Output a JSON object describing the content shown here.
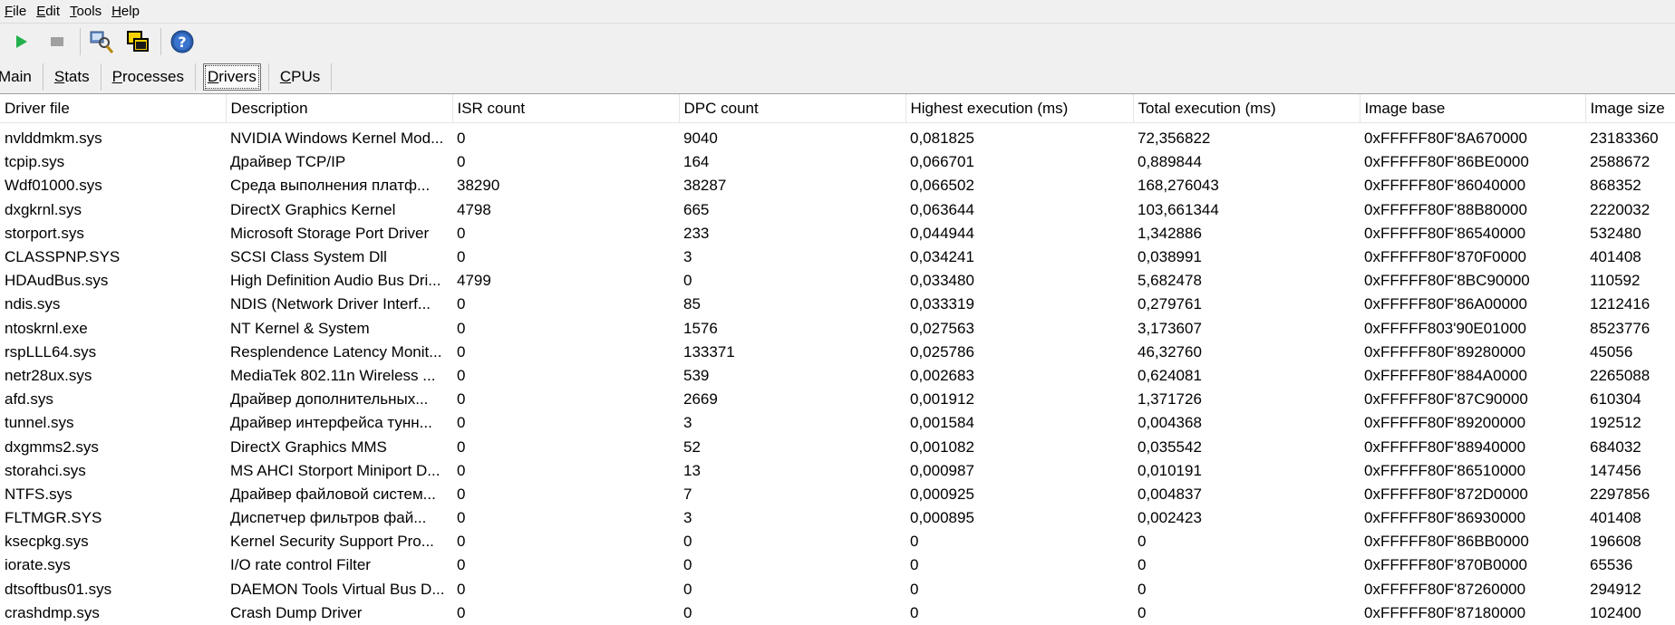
{
  "menu": [
    "File",
    "Edit",
    "Tools",
    "Help"
  ],
  "toolbar": {
    "start": "play-icon",
    "stop": "stop-icon",
    "search": "search-driver-icon",
    "windows": "copy-windows-icon",
    "help": "help-icon"
  },
  "tabs": [
    "Main",
    "Stats",
    "Processes",
    "Drivers",
    "CPUs"
  ],
  "active_tab": "Drivers",
  "colors": {
    "play": "#22b14c",
    "help": "#2a5caa",
    "chrome": "#f0f0f0"
  },
  "table": {
    "columns": [
      "Driver file",
      "Description",
      "ISR count",
      "DPC count",
      "Highest execution (ms)",
      "Total execution (ms)",
      "Image base",
      "Image size"
    ],
    "rows": [
      [
        "nvlddmkm.sys",
        "NVIDIA Windows Kernel Mod...",
        "0",
        "9040",
        "0,081825",
        "72,356822",
        "0xFFFFF80F'8A670000",
        "23183360"
      ],
      [
        "tcpip.sys",
        "Драйвер TCP/IP",
        "0",
        "164",
        "0,066701",
        "0,889844",
        "0xFFFFF80F'86BE0000",
        "2588672"
      ],
      [
        "Wdf01000.sys",
        "Среда выполнения платф...",
        "38290",
        "38287",
        "0,066502",
        "168,276043",
        "0xFFFFF80F'86040000",
        "868352"
      ],
      [
        "dxgkrnl.sys",
        "DirectX Graphics Kernel",
        "4798",
        "665",
        "0,063644",
        "103,661344",
        "0xFFFFF80F'88B80000",
        "2220032"
      ],
      [
        "storport.sys",
        "Microsoft Storage Port Driver",
        "0",
        "233",
        "0,044944",
        "1,342886",
        "0xFFFFF80F'86540000",
        "532480"
      ],
      [
        "CLASSPNP.SYS",
        "SCSI Class System Dll",
        "0",
        "3",
        "0,034241",
        "0,038991",
        "0xFFFFF80F'870F0000",
        "401408"
      ],
      [
        "HDAudBus.sys",
        "High Definition Audio Bus Dri...",
        "4799",
        "0",
        "0,033480",
        "5,682478",
        "0xFFFFF80F'8BC90000",
        "110592"
      ],
      [
        "ndis.sys",
        "NDIS (Network Driver Interf...",
        "0",
        "85",
        "0,033319",
        "0,279761",
        "0xFFFFF80F'86A00000",
        "1212416"
      ],
      [
        "ntoskrnl.exe",
        "NT Kernel & System",
        "0",
        "1576",
        "0,027563",
        "3,173607",
        "0xFFFFF803'90E01000",
        "8523776"
      ],
      [
        "rspLLL64.sys",
        "Resplendence Latency Monit...",
        "0",
        "133371",
        "0,025786",
        "46,32760",
        "0xFFFFF80F'89280000",
        "45056"
      ],
      [
        "netr28ux.sys",
        "MediaTek 802.11n Wireless ...",
        "0",
        "539",
        "0,002683",
        "0,624081",
        "0xFFFFF80F'884A0000",
        "2265088"
      ],
      [
        "afd.sys",
        "Драйвер дополнительных...",
        "0",
        "2669",
        "0,001912",
        "1,371726",
        "0xFFFFF80F'87C90000",
        "610304"
      ],
      [
        "tunnel.sys",
        "Драйвер интерфейса тунн...",
        "0",
        "3",
        "0,001584",
        "0,004368",
        "0xFFFFF80F'89200000",
        "192512"
      ],
      [
        "dxgmms2.sys",
        "DirectX Graphics MMS",
        "0",
        "52",
        "0,001082",
        "0,035542",
        "0xFFFFF80F'88940000",
        "684032"
      ],
      [
        "storahci.sys",
        "MS AHCI Storport Miniport D...",
        "0",
        "13",
        "0,000987",
        "0,010191",
        "0xFFFFF80F'86510000",
        "147456"
      ],
      [
        "NTFS.sys",
        "Драйвер файловой систем...",
        "0",
        "7",
        "0,000925",
        "0,004837",
        "0xFFFFF80F'872D0000",
        "2297856"
      ],
      [
        "FLTMGR.SYS",
        "Диспетчер фильтров фай...",
        "0",
        "3",
        "0,000895",
        "0,002423",
        "0xFFFFF80F'86930000",
        "401408"
      ],
      [
        "ksecpkg.sys",
        "Kernel Security Support Pro...",
        "0",
        "0",
        "0",
        "0",
        "0xFFFFF80F'86BB0000",
        "196608"
      ],
      [
        "iorate.sys",
        "I/O rate control Filter",
        "0",
        "0",
        "0",
        "0",
        "0xFFFFF80F'870B0000",
        "65536"
      ],
      [
        "dtsoftbus01.sys",
        "DAEMON Tools Virtual Bus D...",
        "0",
        "0",
        "0",
        "0",
        "0xFFFFF80F'87260000",
        "294912"
      ],
      [
        "crashdmp.sys",
        "Crash Dump Driver",
        "0",
        "0",
        "0",
        "0",
        "0xFFFFF80F'87180000",
        "102400"
      ]
    ]
  }
}
